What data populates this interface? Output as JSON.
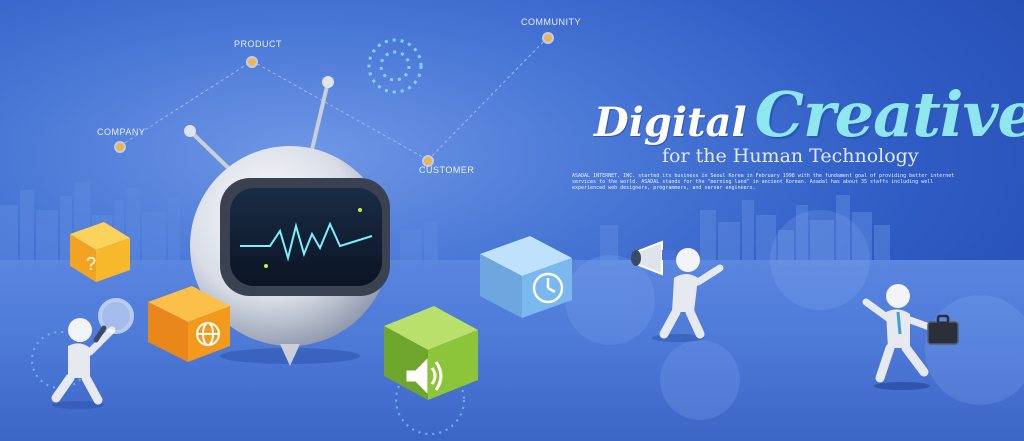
{
  "network": {
    "company": "COMPANY",
    "product": "PRODUCT",
    "community": "COMMUNITY",
    "customer": "CUSTOMER"
  },
  "headline": {
    "word1": "Digital",
    "word2": "Creative",
    "subtitle": "for the Human Technology",
    "blurb": "ASADAL INTERNET, INC. started its business in Seoul Korea in February 1998 with the fundament goal of providing better internet services to the world. ASADAL stands for the \"morning land\" in ancient Korean. Asadal has about 35 staffs including well experienced web designers, programmers, and server engineers."
  },
  "colors": {
    "background": "#3a66cc",
    "accent_title": "#8fe6ef",
    "node": "#f2b545",
    "cube_yellow": "#f5b92b",
    "cube_orange": "#f39a1d",
    "cube_green": "#8cc43a",
    "cube_blue": "#7ab8ee"
  },
  "icons": [
    "question-icon",
    "globe-icon",
    "speaker-icon",
    "clock-icon",
    "magnifier-icon",
    "megaphone-icon",
    "briefcase-icon"
  ]
}
